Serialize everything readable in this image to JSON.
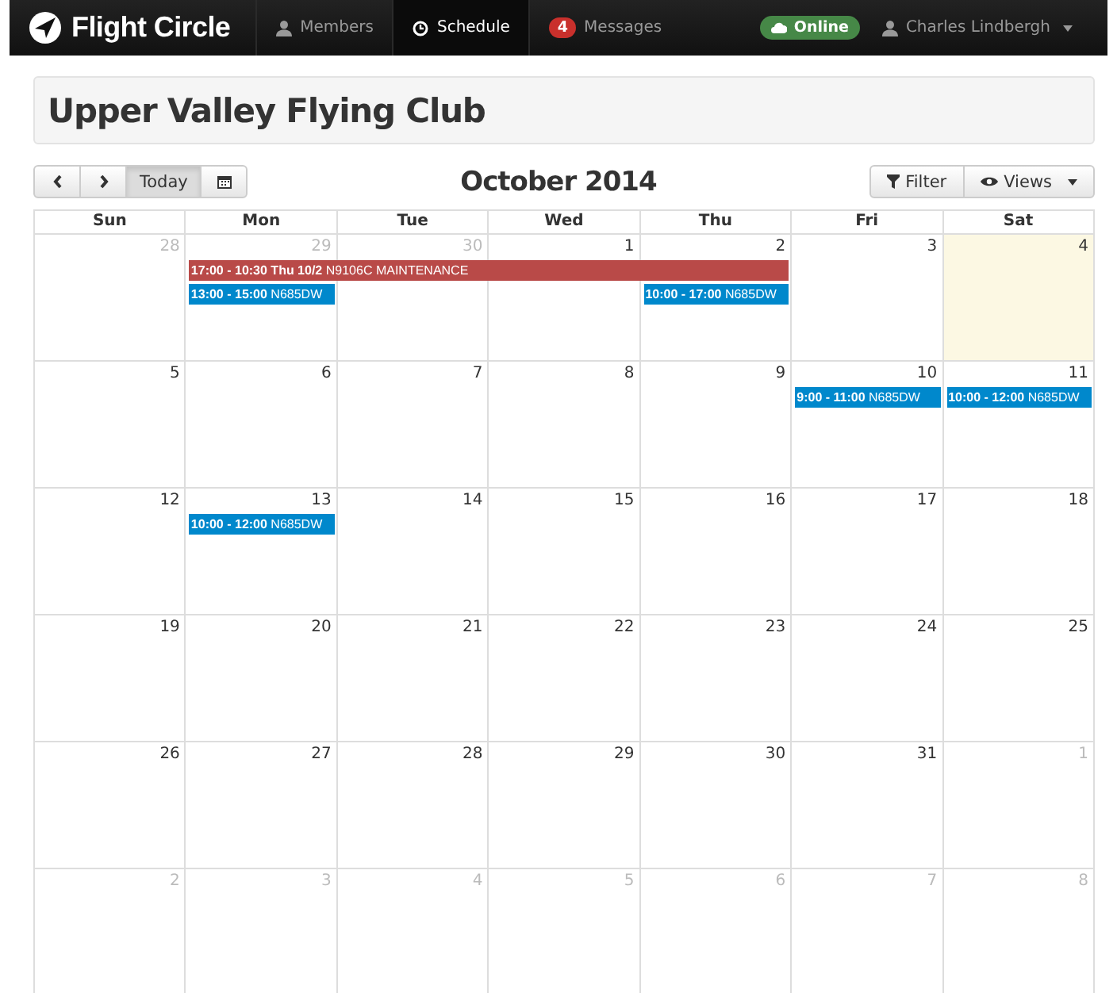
{
  "navbar": {
    "brand": "Flight Circle",
    "items": [
      {
        "label": "Members",
        "selected": false
      },
      {
        "label": "Schedule",
        "selected": true
      },
      {
        "label": "Messages",
        "badge": "4",
        "selected": false
      }
    ],
    "status": "Online",
    "user": "Charles Lindbergh"
  },
  "club_title": "Upper Valley Flying Club",
  "toolbar": {
    "nav_buttons": [
      {
        "kind": "prev"
      },
      {
        "kind": "next"
      },
      {
        "kind": "text",
        "label": "Today",
        "selected": true
      },
      {
        "kind": "calendar"
      }
    ],
    "month": "October 2014",
    "right_buttons": [
      {
        "kind": "filter",
        "label": "Filter"
      },
      {
        "kind": "views",
        "label": "Views"
      }
    ]
  },
  "calendar": {
    "weekdays": [
      "Sun",
      "Mon",
      "Tue",
      "Wed",
      "Thu",
      "Fri",
      "Sat"
    ],
    "weeks": [
      {
        "days": [
          {
            "number": "28",
            "other_month": true,
            "today": false
          },
          {
            "number": "29",
            "other_month": true,
            "today": false,
            "events": [
              {
                "text": "**17:00 - 10:30 Thu 10/2** N9106C MAINTENANCE",
                "color": "#b94a48"
              },
              {
                "text": "**13:00 - 15:00** N685DW",
                "color": "#0088cc"
              }
            ]
          },
          {
            "number": "30",
            "other_month": true,
            "today": false,
            "continued_event": true
          },
          {
            "number": "1",
            "other_month": false,
            "today": false,
            "continued_event": true
          },
          {
            "number": "2",
            "other_month": false,
            "today": false,
            "continued_event": true,
            "events": [
              {
                "text": "**10:00 - 17:00** N685DW",
                "color": "#0088cc"
              }
            ]
          },
          {
            "number": "3",
            "other_month": false,
            "today": false
          },
          {
            "number": "4",
            "other_month": false,
            "today": true
          }
        ]
      },
      {
        "days": [
          {
            "number": "5",
            "other_month": false,
            "today": false
          },
          {
            "number": "6",
            "other_month": false,
            "today": false
          },
          {
            "number": "7",
            "other_month": false,
            "today": false
          },
          {
            "number": "8",
            "other_month": false,
            "today": false
          },
          {
            "number": "9",
            "other_month": false,
            "today": false
          },
          {
            "number": "10",
            "other_month": false,
            "today": false,
            "events": [
              {
                "text": "**9:00 - 11:00** N685DW",
                "color": "#0088cc"
              }
            ]
          },
          {
            "number": "11",
            "other_month": false,
            "today": false,
            "events": [
              {
                "text": "**10:00 - 12:00** N685DW",
                "color": "#0088cc"
              }
            ]
          }
        ]
      },
      {
        "days": [
          {
            "number": "12",
            "other_month": false,
            "today": false
          },
          {
            "number": "13",
            "other_month": false,
            "today": false,
            "events": [
              {
                "text": "**10:00 - 12:00** N685DW",
                "color": "#0088cc"
              }
            ]
          },
          {
            "number": "14",
            "other_month": false,
            "today": false
          },
          {
            "number": "15",
            "other_month": false,
            "today": false
          },
          {
            "number": "16",
            "other_month": false,
            "today": false
          },
          {
            "number": "17",
            "other_month": false,
            "today": false
          },
          {
            "number": "18",
            "other_month": false,
            "today": false
          }
        ]
      },
      {
        "days": [
          {
            "number": "19",
            "other_month": false,
            "today": false
          },
          {
            "number": "20",
            "other_month": false,
            "today": false
          },
          {
            "number": "21",
            "other_month": false,
            "today": false
          },
          {
            "number": "22",
            "other_month": false,
            "today": false
          },
          {
            "number": "23",
            "other_month": false,
            "today": false
          },
          {
            "number": "24",
            "other_month": false,
            "today": false
          },
          {
            "number": "25",
            "other_month": false,
            "today": false
          }
        ]
      },
      {
        "days": [
          {
            "number": "26",
            "other_month": false,
            "today": false
          },
          {
            "number": "27",
            "other_month": false,
            "today": false
          },
          {
            "number": "28",
            "other_month": false,
            "today": false
          },
          {
            "number": "29",
            "other_month": false,
            "today": false
          },
          {
            "number": "30",
            "other_month": false,
            "today": false
          },
          {
            "number": "31",
            "other_month": false,
            "today": false
          },
          {
            "number": "1",
            "other_month": true,
            "today": false
          }
        ]
      },
      {
        "days": [
          {
            "number": "2",
            "other_month": true,
            "today": false
          },
          {
            "number": "3",
            "other_month": true,
            "today": false
          },
          {
            "number": "4",
            "other_month": true,
            "today": false
          },
          {
            "number": "5",
            "other_month": true,
            "today": false
          },
          {
            "number": "6",
            "other_month": true,
            "today": false
          },
          {
            "number": "7",
            "other_month": true,
            "today": false
          },
          {
            "number": "8",
            "other_month": true,
            "today": false
          }
        ]
      }
    ]
  }
}
